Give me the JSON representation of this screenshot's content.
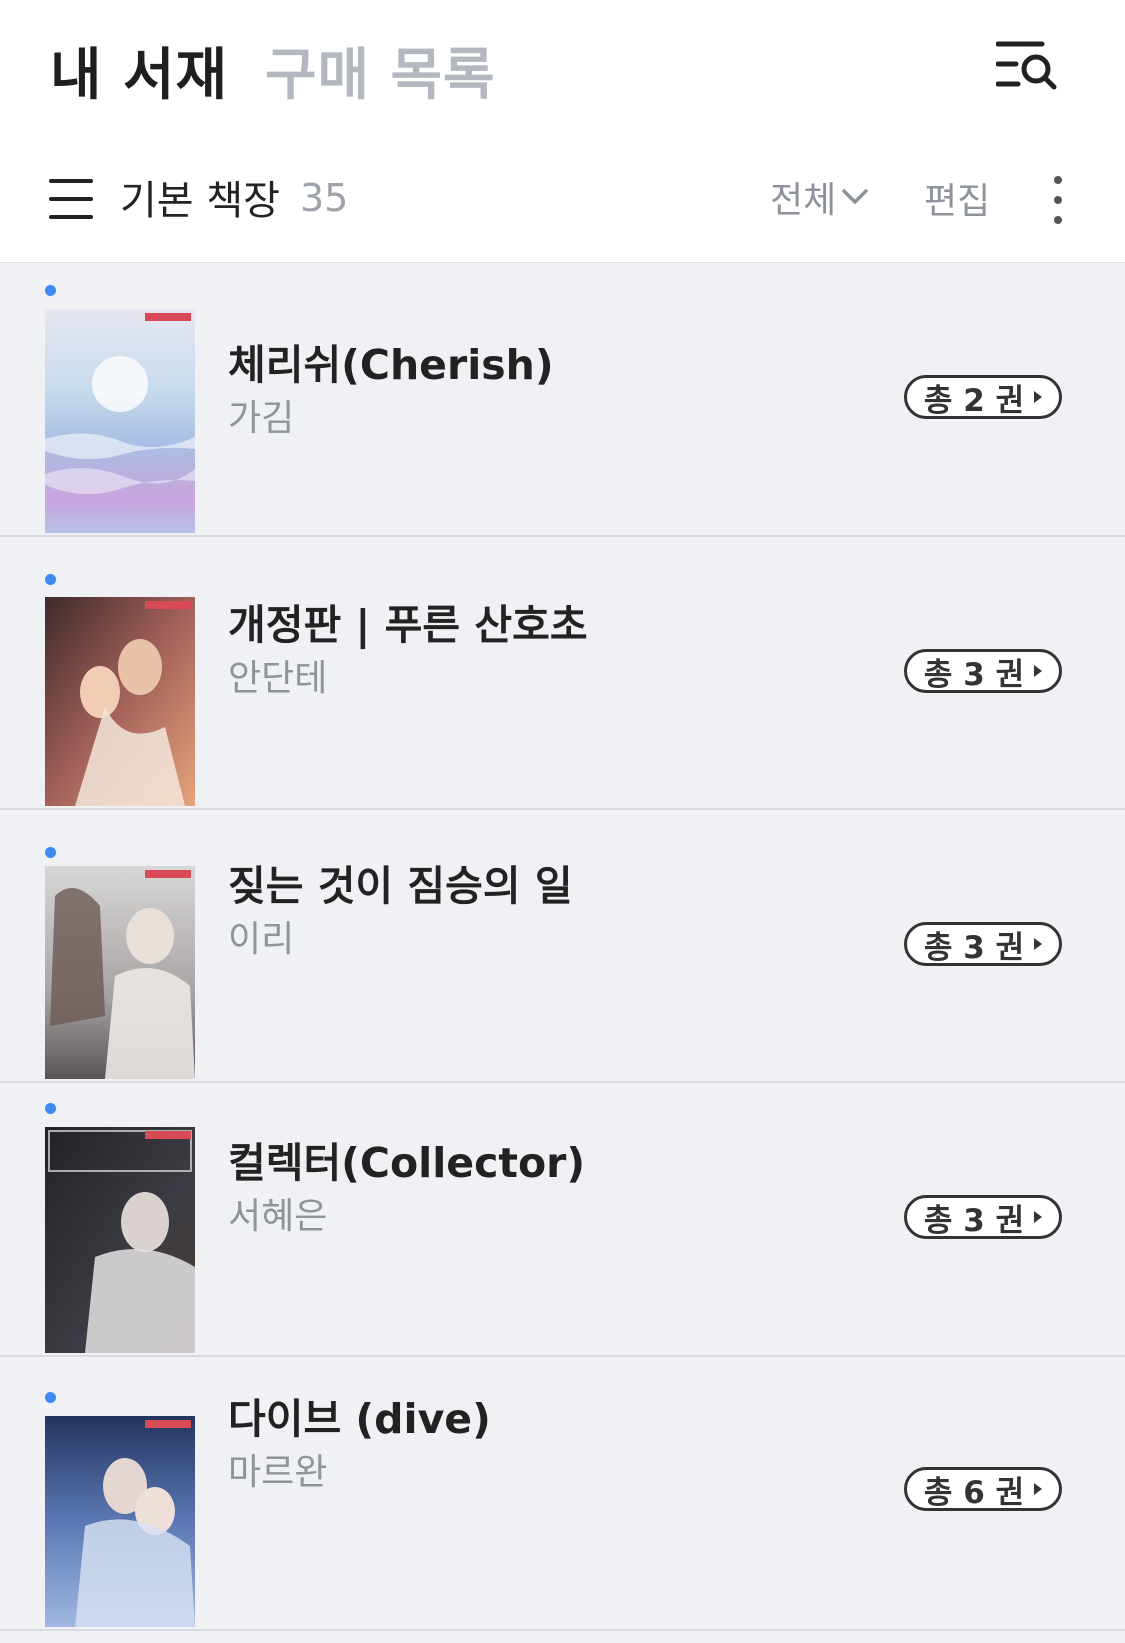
{
  "header": {
    "tabs": [
      {
        "label": "내 서재",
        "active": true
      },
      {
        "label": "구매 목록",
        "active": false
      }
    ]
  },
  "shelf_bar": {
    "title": "기본 책장",
    "count": "35",
    "filter_label": "전체",
    "edit_label": "편집"
  },
  "colors": {
    "accent_dot": "#3d8bf0",
    "background": "#f0f1f4",
    "inactive_tab": "#b3b7bf"
  },
  "books": [
    {
      "title": "체리쉬(Cherish)",
      "author": "가김",
      "volumes": "총 2 권",
      "is_new": true
    },
    {
      "title": "개정판 | 푸른 산호초",
      "author": "안단테",
      "volumes": "총 3 권",
      "is_new": true
    },
    {
      "title": "짖는 것이 짐승의 일",
      "author": "이리",
      "volumes": "총 3 권",
      "is_new": true
    },
    {
      "title": "컬렉터(Collector)",
      "author": "서혜은",
      "volumes": "총 3 권",
      "is_new": true
    },
    {
      "title": "다이브 (dive)",
      "author": "마르완",
      "volumes": "총 6 권",
      "is_new": true
    }
  ]
}
